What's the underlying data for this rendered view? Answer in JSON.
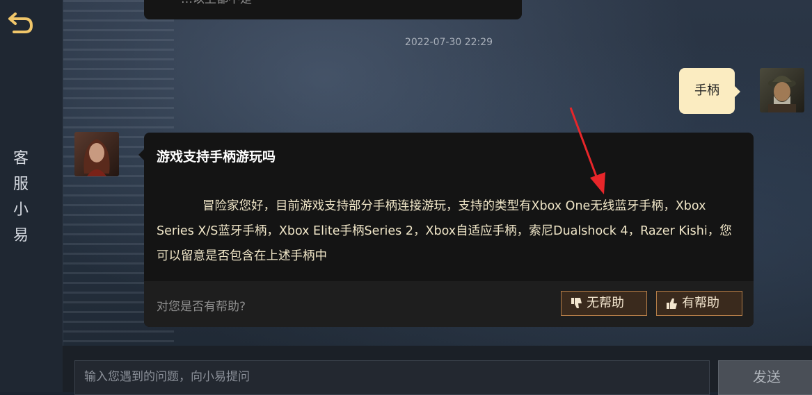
{
  "sidebar": {
    "title_chars": [
      "客",
      "服",
      "小",
      "易"
    ]
  },
  "chat": {
    "prev_message_fragment": "一…以上都不是",
    "timestamp": "2022-07-30 22:29",
    "user_message": "手柄",
    "bot_card": {
      "title": "游戏支持手柄游玩吗",
      "body": "冒险家您好，目前游戏支持部分手柄连接游玩，支持的类型有Xbox One无线蓝牙手柄，Xbox Series X/S蓝牙手柄，Xbox Elite手柄Series 2，Xbox自适应手柄，索尼Dualshock 4，Razer Kishi，您可以留意是否包含在上述手柄中",
      "feedback_question": "对您是否有帮助?",
      "not_helpful_label": "无帮助",
      "helpful_label": "有帮助"
    }
  },
  "composer": {
    "placeholder": "输入您遇到的问题，向小易提问",
    "send_label": "发送"
  },
  "colors": {
    "user_bubble": "#fbecc1",
    "card_bg": "#141414",
    "body_text": "#f0e6c8",
    "button_border": "#b47d48",
    "annotation_arrow": "#e8262a"
  },
  "icons": {
    "back": "return-arrow-icon",
    "not_helpful": "thumbs-down-icon",
    "helpful": "thumbs-up-icon"
  }
}
